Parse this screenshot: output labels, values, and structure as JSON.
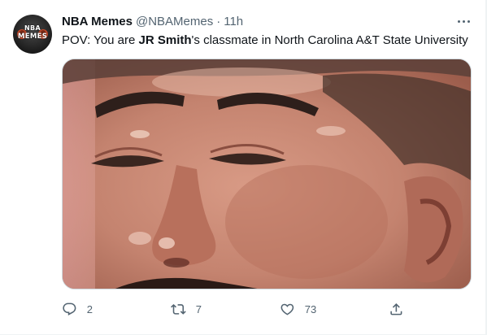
{
  "author": {
    "display_name": "NBA Memes",
    "handle": "@NBAMemes",
    "separator": "·",
    "time": "11h",
    "avatar_logo_line1": "NBA",
    "avatar_logo_line2": "MEMES"
  },
  "tweet": {
    "text_before": "POV: You are ",
    "text_bold": "JR Smith",
    "text_after": "'s classmate in North Carolina A&T State University",
    "media_icon": "photo-closeup-face"
  },
  "actions": {
    "reply_icon": "reply-icon",
    "reply_count": "2",
    "retweet_icon": "retweet-icon",
    "retweet_count": "7",
    "like_icon": "like-icon",
    "like_count": "73",
    "share_icon": "share-icon"
  },
  "colors": {
    "text_primary": "#0f1419",
    "text_secondary": "#536471",
    "border": "#cfd9de"
  }
}
